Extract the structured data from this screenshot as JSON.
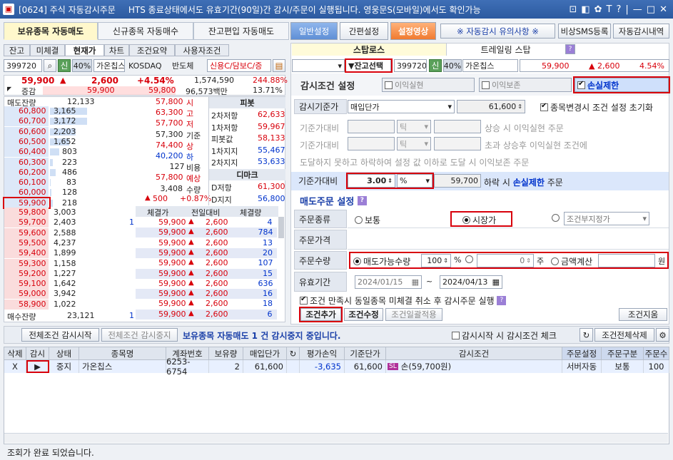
{
  "window": {
    "title": "[0624] 주식 자동감시주문",
    "notice": "HTS 종료상태에서도 유효기간(90일)간 감시/주문이 실행됩니다. 영웅문S(모바일)에서도 확인가능",
    "titlebar_icons": [
      "⊡",
      "◧",
      "✿",
      "T",
      "?",
      "|",
      "—",
      "□",
      "✕"
    ]
  },
  "top_tabs": [
    "보유종목 자동매도",
    "신규종목 자동매수",
    "잔고편입 자동매도"
  ],
  "top_buttons": {
    "general": "일반설정",
    "simple": "간편설정",
    "video": "설정영상",
    "caution": "※ 자동감시 유의사항 ※",
    "sms": "비상SMS등록",
    "history": "자동감시내역"
  },
  "left_tabs": [
    "잔고",
    "미체결",
    "현재가",
    "차트",
    "조건요약",
    "사용자조건"
  ],
  "left_code": {
    "code": "399720",
    "credit": "신",
    "pct": "40%",
    "name": "가온칩스",
    "market": "KOSDAQ",
    "sector": "반도체",
    "loan": "신용C/담보C/증"
  },
  "price_row": {
    "price": "59,900",
    "change_sign": "▲",
    "change": "2,600",
    "rate": "+4.54%",
    "volume": "1,574,590",
    "vol_rate": "244.88%"
  },
  "price_row2": {
    "label": "증감",
    "v1": "59,900",
    "v2": "59,800",
    "amount": "96,573백만",
    "rate": "13.71%"
  },
  "ob_header": {
    "sell": "매도잔량",
    "sell_total": "12,133",
    "buy": "매수잔량",
    "buy_total": "23,121",
    "buy_cnt": "1"
  },
  "ask": [
    {
      "q": "3,165",
      "p": "60,800"
    },
    {
      "q": "3,172",
      "p": "60,700"
    },
    {
      "q": "2,203",
      "p": "60,600"
    },
    {
      "q": "1,652",
      "p": "60,500"
    },
    {
      "q": "803",
      "p": "60,400"
    },
    {
      "q": "223",
      "p": "60,300"
    },
    {
      "q": "486",
      "p": "60,200"
    },
    {
      "q": "83",
      "p": "60,100"
    },
    {
      "q": "128",
      "p": "60,000"
    },
    {
      "q": "218",
      "p": "59,900"
    }
  ],
  "bid": [
    {
      "q": "3,003",
      "p": "59,800"
    },
    {
      "q": "2,403",
      "p": "59,700",
      "c": "1"
    },
    {
      "q": "2,588",
      "p": "59,600"
    },
    {
      "q": "4,237",
      "p": "59,500"
    },
    {
      "q": "1,899",
      "p": "59,400"
    },
    {
      "q": "1,158",
      "p": "59,300"
    },
    {
      "q": "1,227",
      "p": "59,200"
    },
    {
      "q": "1,642",
      "p": "59,100"
    },
    {
      "q": "3,942",
      "p": "59,000"
    },
    {
      "q": "1,022",
      "p": "58,900"
    }
  ],
  "mid_info": [
    {
      "v": "57,800",
      "k": "시"
    },
    {
      "v": "63,300",
      "k": "고"
    },
    {
      "v": "57,700",
      "k": "저"
    },
    {
      "v": "57,300",
      "k": "기준"
    },
    {
      "v": "74,400",
      "k": "상"
    },
    {
      "v": "40,200",
      "k": "하"
    },
    {
      "v": "127",
      "k": "비용"
    },
    {
      "v": "57,800",
      "k": "예상"
    },
    {
      "v": "3,408",
      "k": "수량"
    }
  ],
  "mid_bottom": {
    "arrow": "▲",
    "chg": "500",
    "rate": "+0.87%"
  },
  "pivot": {
    "title": "피봇",
    "rows": [
      {
        "k": "2차저항",
        "v": "62,633"
      },
      {
        "k": "1차저항",
        "v": "59,967"
      },
      {
        "k": "피봇값",
        "v": "58,133"
      },
      {
        "k": "1차지지",
        "v": "55,467"
      },
      {
        "k": "2차지지",
        "v": "53,633"
      }
    ]
  },
  "demark": {
    "title": "디마크",
    "rows": [
      {
        "k": "D저항",
        "v": "61,300"
      },
      {
        "k": "D지지",
        "v": "56,800"
      }
    ]
  },
  "trades_header": [
    "체결가",
    "전일대비",
    "체결량"
  ],
  "trades": [
    {
      "p": "59,900",
      "c": "2,600",
      "q": "4"
    },
    {
      "p": "59,900",
      "c": "2,600",
      "q": "784"
    },
    {
      "p": "59,900",
      "c": "2,600",
      "q": "13"
    },
    {
      "p": "59,900",
      "c": "2,600",
      "q": "20"
    },
    {
      "p": "59,900",
      "c": "2,600",
      "q": "107"
    },
    {
      "p": "59,900",
      "c": "2,600",
      "q": "15"
    },
    {
      "p": "59,900",
      "c": "2,600",
      "q": "636"
    },
    {
      "p": "59,900",
      "c": "2,600",
      "q": "16"
    },
    {
      "p": "59,900",
      "c": "2,600",
      "q": "18"
    },
    {
      "p": "59,900",
      "c": "2,600",
      "q": "6"
    }
  ],
  "right_tabs": {
    "status": "스탑로스",
    "trailing": "트레일링 스탑"
  },
  "right_code": {
    "select": "▼잔고선택",
    "code": "399720",
    "credit": "신",
    "pct": "40%",
    "name": "가온칩스",
    "price": "59,900",
    "sign": "▲",
    "chg": "2,600",
    "rate": "4.54%"
  },
  "cond": {
    "title": "감시조건 설정",
    "profit": "이익실현",
    "preserve": "이익보존",
    "stoploss": "손실제한"
  },
  "base": {
    "label": "감시기준가",
    "select": "매입단가",
    "value": "61,600",
    "reset": "종목변경시 조건 설정 초기화"
  },
  "base_rows": [
    {
      "label": "기준가대비",
      "unit": "틱",
      "text": "상승 시    이익실현    주문"
    },
    {
      "label": "기준가대비",
      "unit": "틱",
      "text": "초과 상승후 이익실현 조건에"
    },
    {
      "label": "",
      "unit": "",
      "text": "도달하지 못하고 하락하여 설정 값 이하로 도달 시  이익보존  주문"
    }
  ],
  "stop_row": {
    "label": "기준가대비",
    "value": "3.00",
    "unit": "%",
    "price": "59,700",
    "text1": "하락 시",
    "strong": "손실제한",
    "text2": "주문"
  },
  "sell": {
    "title": "매도주문 설정",
    "type_label": "주문종류",
    "normal": "보통",
    "market": "시장가",
    "cond": "조건부지정가",
    "price_label": "주문가격",
    "qty_label": "주문수량",
    "sellable": "매도가능수량",
    "qty_pct": "100",
    "pct_unit": "%",
    "qty_val": "0",
    "qty_unit": "주",
    "amount": "금액계산",
    "won": "원",
    "valid_label": "유효기간",
    "from": "2024/01/15",
    "tilde": "~",
    "to": "2024/04/13"
  },
  "cancel_note": "조건 만족시 동일종목 미체결 취소 후 감시주문 실행",
  "cond_buttons": {
    "add": "조건추가",
    "modify": "조건수정",
    "batch": "조건일괄적용",
    "delete": "조건지움"
  },
  "status_bar": {
    "start_all": "전체조건 감시시작",
    "stop_all": "전체조건 감시중지",
    "message": "보유종목 자동매도 1 건 감시중지 중입니다.",
    "check": "감시시작 시 감시조건 체크",
    "delete_all": "조건전체삭제"
  },
  "table": {
    "headers": [
      "삭제",
      "감시",
      "상태",
      "종목명",
      "계좌번호",
      "보유량",
      "매입단가",
      "",
      "평가손익",
      "기준단가",
      "감시조건",
      "주문설정",
      "주문구분",
      "주문수"
    ],
    "rows": [
      {
        "del": "X",
        "watch": "▶",
        "state": "중지",
        "name": "가온칩스",
        "account": "6253-6754",
        "qty": "2",
        "buy": "61,600",
        "pnl": "-3,635",
        "base": "61,600",
        "sl": "SL",
        "cond": "손(59,700원)",
        "set": "서버자동",
        "kind": "보통",
        "cnt": "100"
      }
    ]
  },
  "footer": "조회가 완료 되었습니다."
}
